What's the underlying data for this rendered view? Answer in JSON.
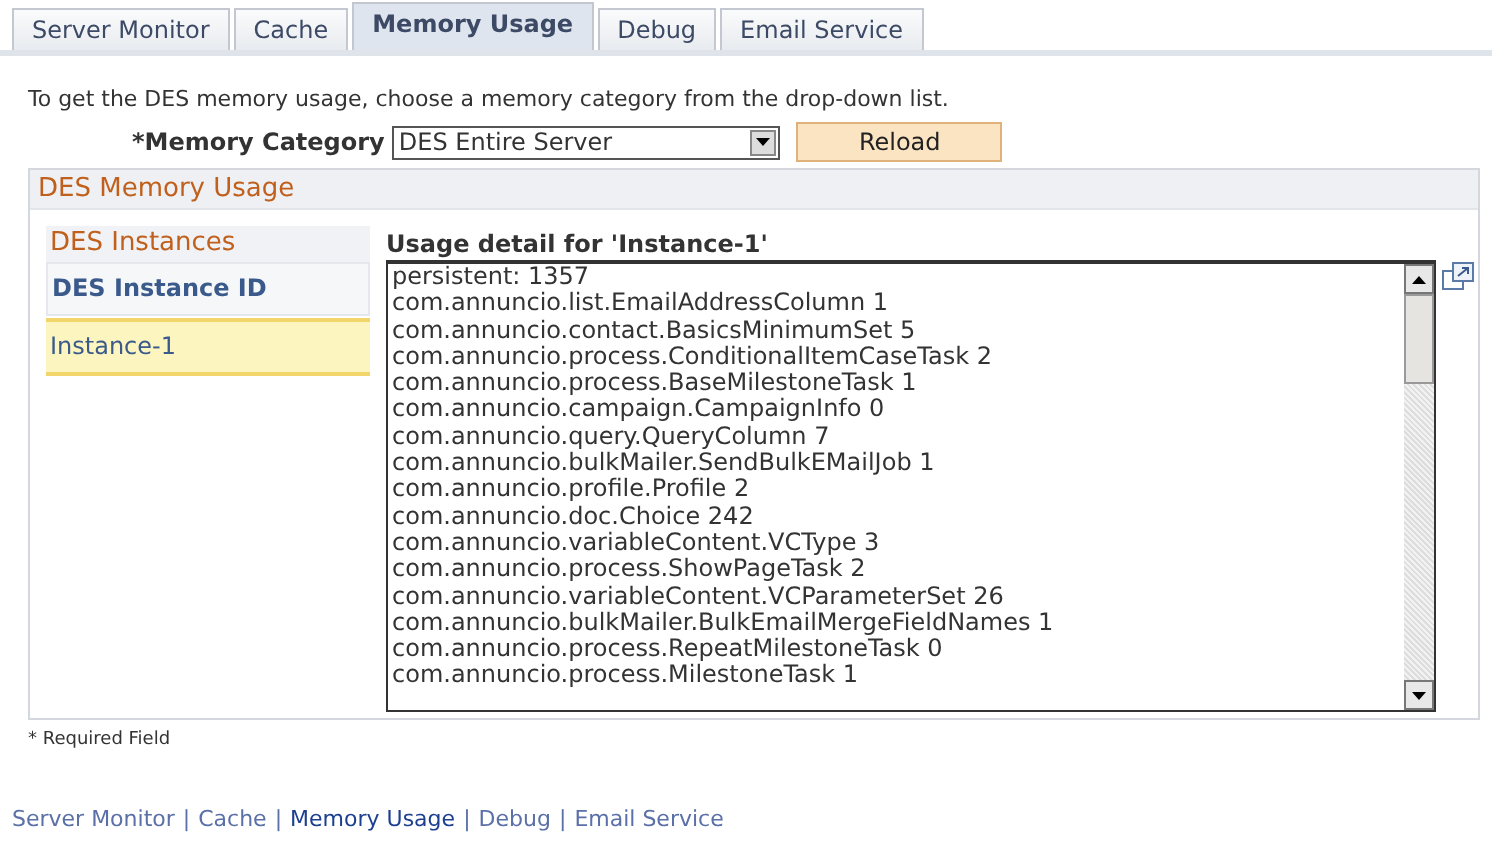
{
  "tabs": [
    {
      "label": "Server Monitor",
      "selected": false
    },
    {
      "label": "Cache",
      "selected": false
    },
    {
      "label": "Memory Usage",
      "selected": true
    },
    {
      "label": "Debug",
      "selected": false
    },
    {
      "label": "Email Service",
      "selected": false
    }
  ],
  "instruction": "To get the DES memory usage, choose a memory category from the drop-down list.",
  "memory_category": {
    "label": "*Memory Category",
    "value": "DES Entire Server"
  },
  "reload_button": "Reload",
  "group": {
    "title": "DES Memory Usage",
    "instances": {
      "title": "DES Instances",
      "column": "DES Instance ID",
      "rows": [
        {
          "id": "Instance-1",
          "selected": true
        }
      ]
    },
    "usage_label": "Usage detail for 'Instance-1'",
    "usage_lines": [
      "persistent: 1357",
      "com.annuncio.list.EmailAddressColumn 1",
      "com.annuncio.contact.BasicsMinimumSet 5",
      "com.annuncio.process.ConditionalItemCaseTask 2",
      "com.annuncio.process.BaseMilestoneTask 1",
      "com.annuncio.campaign.CampaignInfo 0",
      "com.annuncio.query.QueryColumn 7",
      "com.annuncio.bulkMailer.SendBulkEMailJob 1",
      "com.annuncio.profile.Profile 2",
      "com.annuncio.doc.Choice 242",
      "com.annuncio.variableContent.VCType 3",
      "com.annuncio.process.ShowPageTask 2",
      "com.annuncio.variableContent.VCParameterSet 26",
      "com.annuncio.bulkMailer.BulkEmailMergeFieldNames 1",
      "com.annuncio.process.RepeatMilestoneTask 0",
      "com.annuncio.process.MilestoneTask 1"
    ]
  },
  "required_note": "* Required Field",
  "footer_separators": [
    "|",
    "|",
    "|",
    "|"
  ],
  "footer_links": [
    {
      "label": "Server Monitor",
      "selected": false
    },
    {
      "label": "Cache",
      "selected": false
    },
    {
      "label": "Memory Usage",
      "selected": true
    },
    {
      "label": "Debug",
      "selected": false
    },
    {
      "label": "Email Service",
      "selected": false
    }
  ]
}
